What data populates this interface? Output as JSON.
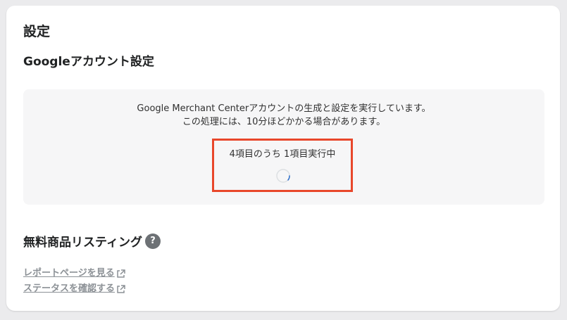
{
  "page": {
    "title": "設定"
  },
  "google_account": {
    "title": "Googleアカウント設定",
    "status_line1": "Google Merchant Centerアカウントの生成と設定を実行しています。",
    "status_line2": "この処理には、10分ほどかかる場合があります。",
    "progress_text": "4項目のうち 1項目実行中",
    "progress_current": 1,
    "progress_total": 4
  },
  "free_listings": {
    "title": "無料商品リスティング",
    "help_icon": "?",
    "links": [
      {
        "label": "レポートページを見る",
        "icon": "external-link-icon"
      },
      {
        "label": "ステータスを確認する",
        "icon": "external-link-icon"
      }
    ]
  },
  "colors": {
    "highlight_border": "#e8472b",
    "link": "#8c9196",
    "panel_bg": "#f6f6f7"
  }
}
